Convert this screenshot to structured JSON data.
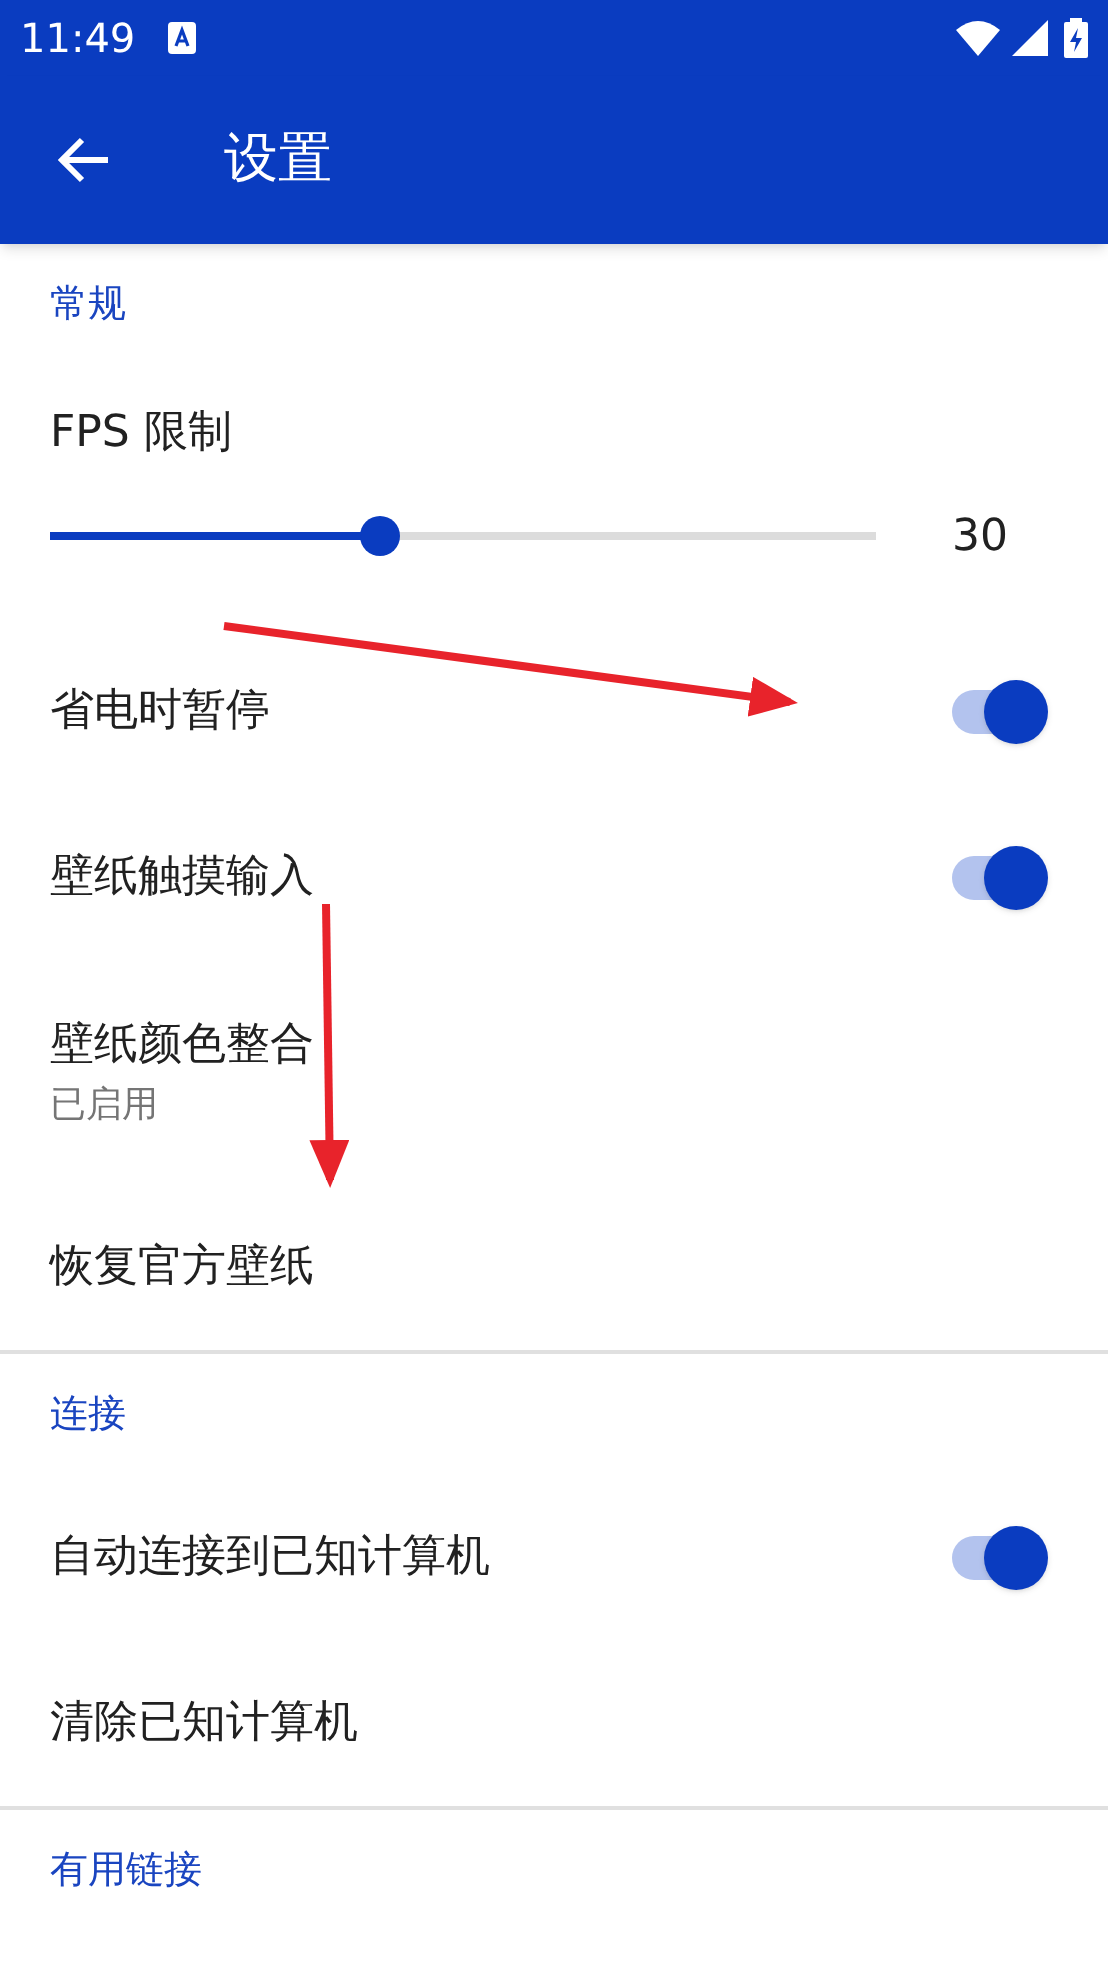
{
  "status_bar": {
    "time": "11:49"
  },
  "app_bar": {
    "title": "设置"
  },
  "sections": [
    {
      "title": "常规",
      "items": [
        {
          "kind": "slider",
          "label": "FPS 限制",
          "level": 0.4,
          "reading": "30"
        },
        {
          "kind": "switch",
          "label": "省电时暂停",
          "on": true
        },
        {
          "kind": "switch",
          "label": "壁纸触摸输入",
          "on": true
        },
        {
          "kind": "text",
          "label": "壁纸颜色整合",
          "summary": "已启用"
        },
        {
          "kind": "text",
          "label": "恢复官方壁纸"
        }
      ]
    },
    {
      "title": "连接",
      "items": [
        {
          "kind": "switch",
          "label": "自动连接到已知计算机",
          "on": true
        },
        {
          "kind": "text",
          "label": "清除已知计算机"
        }
      ]
    },
    {
      "title": "有用链接"
    }
  ]
}
